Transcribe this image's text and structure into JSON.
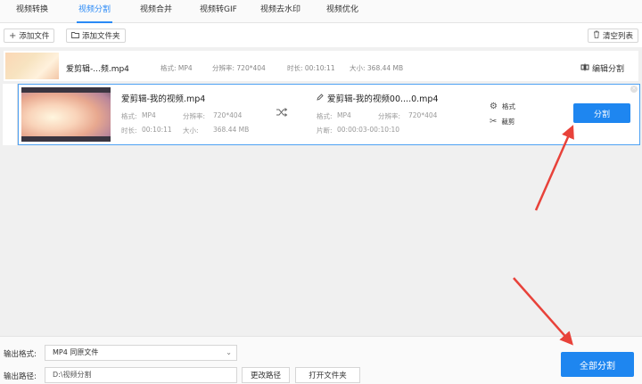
{
  "tabs": [
    {
      "label": "视频转换"
    },
    {
      "label": "视频分割"
    },
    {
      "label": "视频合并"
    },
    {
      "label": "视频转GIF"
    },
    {
      "label": "视频去水印"
    },
    {
      "label": "视频优化"
    }
  ],
  "toolbar": {
    "add_file": "添加文件",
    "add_folder": "添加文件夹",
    "clear_list": "清空列表"
  },
  "file_row": {
    "name": "爱剪辑-...频.mp4",
    "format": "格式: MP4",
    "resolution": "分辨率: 720*404",
    "duration": "时长: 00:10:11",
    "size": "大小: 368.44 MB",
    "edit_label": "编辑分割"
  },
  "segment_row": {
    "source_name": "爱剪辑-我的视频.mp4",
    "src_format_label": "格式:",
    "src_format": "MP4",
    "src_res_label": "分辨率:",
    "src_res": "720*404",
    "src_dur_label": "时长:",
    "src_dur": "00:10:11",
    "src_size_label": "大小:",
    "src_size": "368.44 MB",
    "output_name": "爱剪辑-我的视频00....0.mp4",
    "out_format_label": "格式:",
    "out_format": "MP4",
    "out_res_label": "分辨率:",
    "out_res": "720*404",
    "out_seg_label": "片断:",
    "out_seg": "00:00:03-00:10:10",
    "opt_format": "格式",
    "opt_cut": "裁剪",
    "split_label": "分割"
  },
  "bottom": {
    "output_format_label": "输出格式:",
    "output_format_value": "MP4  同原文件",
    "output_path_label": "输出路径:",
    "output_path_value": "D:\\视频分割",
    "change_path": "更改路径",
    "open_folder": "打开文件夹",
    "split_all": "全部分割"
  },
  "colors": {
    "accent": "#1e86f0",
    "arrow": "#e8423a"
  }
}
